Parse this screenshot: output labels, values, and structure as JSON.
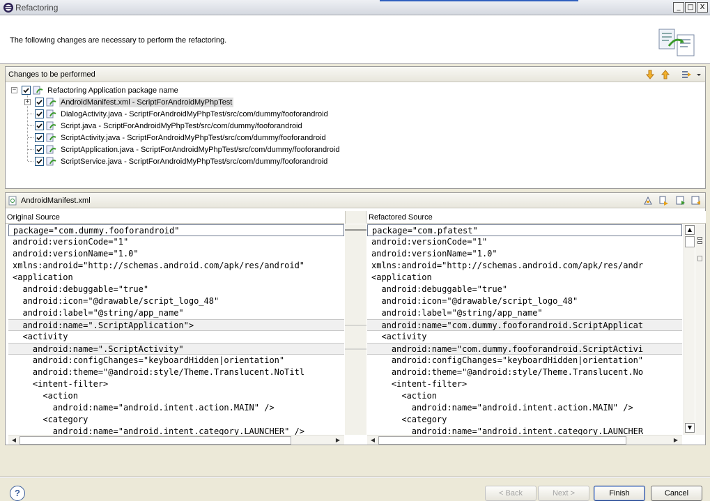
{
  "window": {
    "title": "Refactoring",
    "minimize_glyph": "_",
    "maximize_glyph": "□",
    "close_glyph": "X"
  },
  "header": {
    "message": "The following changes are necessary to perform the refactoring."
  },
  "changes": {
    "title": "Changes to be performed",
    "root": {
      "label": "Refactoring Application package name",
      "checked": true,
      "expander": "−"
    },
    "items": [
      {
        "label": "AndroidManifest.xml - ScriptForAndroidMyPhpTest",
        "checked": true,
        "expander": "+",
        "selected": true
      },
      {
        "label": "DialogActivity.java - ScriptForAndroidMyPhpTest/src/com/dummy/fooforandroid",
        "checked": true
      },
      {
        "label": "Script.java - ScriptForAndroidMyPhpTest/src/com/dummy/fooforandroid",
        "checked": true
      },
      {
        "label": "ScriptActivity.java - ScriptForAndroidMyPhpTest/src/com/dummy/fooforandroid",
        "checked": true
      },
      {
        "label": "ScriptApplication.java - ScriptForAndroidMyPhpTest/src/com/dummy/fooforandroid",
        "checked": true
      },
      {
        "label": "ScriptService.java - ScriptForAndroidMyPhpTest/src/com/dummy/fooforandroid",
        "checked": true
      }
    ]
  },
  "compare": {
    "file_title": "AndroidManifest.xml",
    "left_title": "Original Source",
    "right_title": "Refactored Source",
    "left_lines": [
      "package=\"com.dummy.fooforandroid\"",
      "android:versionCode=\"1\"",
      "android:versionName=\"1.0\"",
      "xmlns:android=\"http://schemas.android.com/apk/res/android\"",
      "<application",
      "  android:debuggable=\"true\"",
      "  android:icon=\"@drawable/script_logo_48\"",
      "  android:label=\"@string/app_name\"",
      "  android:name=\".ScriptApplication\">",
      "  <activity",
      "    android:name=\".ScriptActivity\"",
      "    android:configChanges=\"keyboardHidden|orientation\"",
      "    android:theme=\"@android:style/Theme.Translucent.NoTitl",
      "    <intent-filter>",
      "      <action",
      "        android:name=\"android.intent.action.MAIN\" />",
      "      <category",
      "        android:name=\"android.intent.category.LAUNCHER\" />"
    ],
    "right_lines": [
      "package=\"com.pfatest\"",
      "android:versionCode=\"1\"",
      "android:versionName=\"1.0\"",
      "xmlns:android=\"http://schemas.android.com/apk/res/andr",
      "<application",
      "  android:debuggable=\"true\"",
      "  android:icon=\"@drawable/script_logo_48\"",
      "  android:label=\"@string/app_name\"",
      "  android:name=\"com.dummy.fooforandroid.ScriptApplicat",
      "  <activity",
      "    android:name=\"com.dummy.fooforandroid.ScriptActivi",
      "    android:configChanges=\"keyboardHidden|orientation\"",
      "    android:theme=\"@android:style/Theme.Translucent.No",
      "    <intent-filter>",
      "      <action",
      "        android:name=\"android.intent.action.MAIN\" />",
      "      <category",
      "        android:name=\"android.intent.category.LAUNCHER"
    ],
    "changed_rows": [
      0,
      8,
      10
    ],
    "scroll_up_glyph": "▲",
    "scroll_down_glyph": "▼",
    "scroll_left_glyph": "◀",
    "scroll_right_glyph": "▶"
  },
  "buttons": {
    "help": "?",
    "back": "< Back",
    "next": "Next >",
    "finish": "Finish",
    "cancel": "Cancel"
  },
  "icons": {
    "app": "eclipse-icon",
    "banner": "refactoring-wizard-icon",
    "down": "next-change-arrow-icon",
    "up": "previous-change-arrow-icon",
    "filter": "filter-changes-icon"
  },
  "colors": {
    "accent": "#1c5180",
    "dialog_bg": "#ece9d8",
    "changed_bg": "#e6e6e6",
    "arrow_orange": "#e8a317"
  }
}
